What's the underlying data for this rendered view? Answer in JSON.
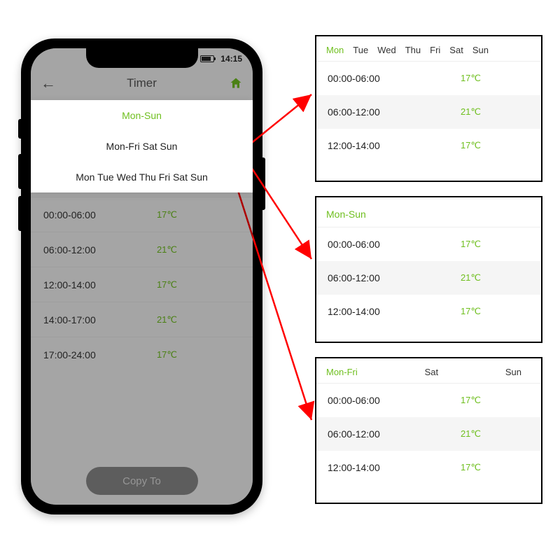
{
  "status_bar": {
    "time": "14:15"
  },
  "header": {
    "title": "Timer"
  },
  "options": [
    {
      "label": "Mon-Sun",
      "active": true
    },
    {
      "label": "Mon-Fri Sat Sun",
      "active": false
    },
    {
      "label": "Mon Tue Wed Thu Fri Sat Sun",
      "active": false
    }
  ],
  "slots": [
    {
      "time": "00:00-06:00",
      "temp": "17℃"
    },
    {
      "time": "06:00-12:00",
      "temp": "21℃"
    },
    {
      "time": "12:00-14:00",
      "temp": "17℃"
    },
    {
      "time": "14:00-17:00",
      "temp": "21℃"
    },
    {
      "time": "17:00-24:00",
      "temp": "17℃"
    }
  ],
  "copy_button": "Copy To",
  "panels": [
    {
      "tabs": [
        "Mon",
        "Tue",
        "Wed",
        "Thu",
        "Fri",
        "Sat",
        "Sun"
      ],
      "active_tab": 0,
      "rows": [
        {
          "time": "00:00-06:00",
          "temp": "17℃",
          "alt": false
        },
        {
          "time": "06:00-12:00",
          "temp": "21℃",
          "alt": true
        },
        {
          "time": "12:00-14:00",
          "temp": "17℃",
          "alt": false
        }
      ]
    },
    {
      "header": "Mon-Sun",
      "rows": [
        {
          "time": "00:00-06:00",
          "temp": "17℃",
          "alt": false
        },
        {
          "time": "06:00-12:00",
          "temp": "21℃",
          "alt": true
        },
        {
          "time": "12:00-14:00",
          "temp": "17℃",
          "alt": false
        }
      ]
    },
    {
      "tabs3": [
        "Mon-Fri",
        "Sat",
        "Sun"
      ],
      "active_tab": 0,
      "rows": [
        {
          "time": "00:00-06:00",
          "temp": "17℃",
          "alt": false
        },
        {
          "time": "06:00-12:00",
          "temp": "21℃",
          "alt": true
        },
        {
          "time": "12:00-14:00",
          "temp": "17℃",
          "alt": false
        }
      ]
    }
  ]
}
